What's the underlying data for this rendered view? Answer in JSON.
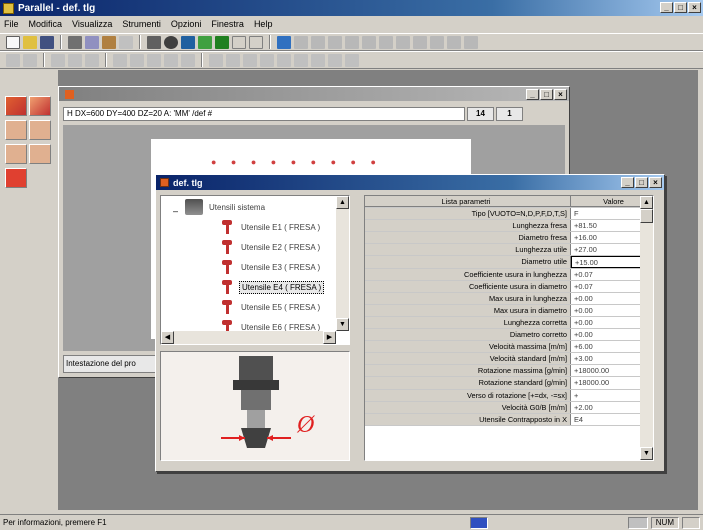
{
  "window": {
    "title": "Parallel - def. tlg"
  },
  "menu": [
    "File",
    "Modifica",
    "Visualizza",
    "Strumenti",
    "Opzioni",
    "Finestra",
    "Help"
  ],
  "mdi": {
    "coords": "H DX=600 DY=400 DZ=20 A: 'MM' /def #",
    "value1": "14",
    "value2": "1",
    "status": "Intestazione del pro"
  },
  "dialog": {
    "title": "def. tlg",
    "tree": {
      "root": "Utensili sistema",
      "items": [
        "Utensile E1 ( FRESA )",
        "Utensile E2 ( FRESA )",
        "Utensile E3 ( FRESA )",
        "Utensile E4 ( FRESA )",
        "Utensile E5 ( FRESA )",
        "Utensile E6 ( FRESA )"
      ],
      "selected_index": 3
    },
    "table": {
      "col_param": "Lista parametri",
      "col_value": "Valore",
      "rows": [
        {
          "name": "Tipo [VUOTO=N,D,P,F,D,T,S]",
          "value": "F"
        },
        {
          "name": "Lunghezza fresa",
          "value": "+81.50"
        },
        {
          "name": "Diametro fresa",
          "value": "+16.00"
        },
        {
          "name": "Lunghezza utile",
          "value": "+27.00"
        },
        {
          "name": "Diametro utile",
          "value": "+15.00"
        },
        {
          "name": "Coefficiente usura in lunghezza",
          "value": "+0.07"
        },
        {
          "name": "Coefficiente usura in diametro",
          "value": "+0.07"
        },
        {
          "name": "Max usura in lunghezza",
          "value": "+0.00"
        },
        {
          "name": "Max usura in diametro",
          "value": "+0.00"
        },
        {
          "name": "Lunghezza corretta",
          "value": "+0.00"
        },
        {
          "name": "Diametro corretto",
          "value": "+0.00"
        },
        {
          "name": "Velocità massima [m/m]",
          "value": "+6.00"
        },
        {
          "name": "Velocità standard [m/m]",
          "value": "+3.00"
        },
        {
          "name": "Rotazione massima [g/min]",
          "value": "+18000.00"
        },
        {
          "name": "Rotazione standard [g/min]",
          "value": "+18000.00"
        },
        {
          "name": "Verso di rotazione [+=dx, -=sx]",
          "value": "+"
        },
        {
          "name": "Velocità G0/B [m/m]",
          "value": "+2.00"
        },
        {
          "name": "Utensile Contrapposto in X",
          "value": "E4"
        }
      ],
      "selected_index": 4
    }
  },
  "statusbar": {
    "text": "Per informazioni, premere F1",
    "num": "NUM"
  },
  "colors": {
    "title_active": "#0a246a",
    "tool_red": "#c03030",
    "face": "#d4d0c8"
  }
}
